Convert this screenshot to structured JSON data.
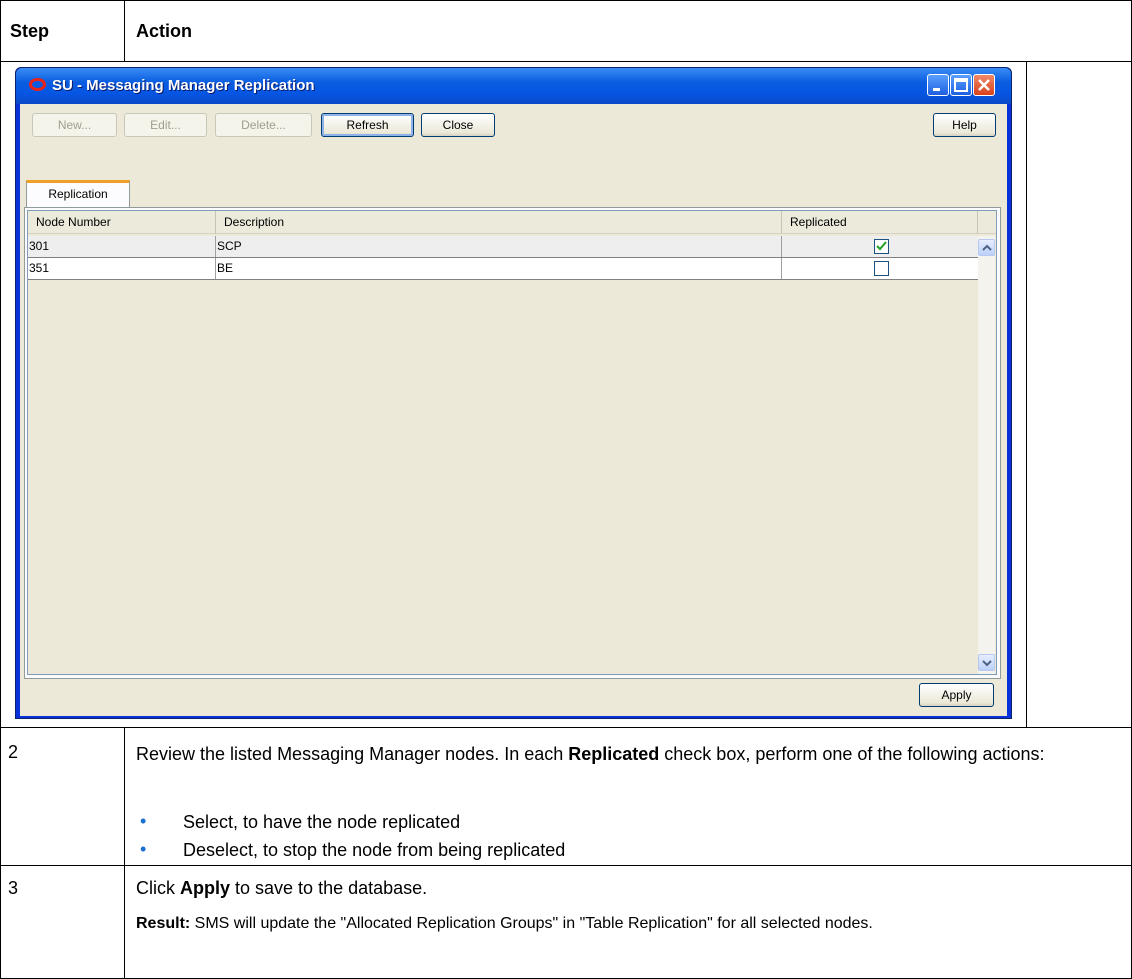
{
  "table": {
    "col_step": "Step",
    "col_action": "Action",
    "rows": [
      {
        "step": "2",
        "intro_pre": "Review the listed Messaging Manager nodes. In each ",
        "intro_bold": "Replicated",
        "intro_post": " check box, perform one of the following actions:",
        "bullets": [
          "Select, to have the node replicated",
          "Deselect, to stop the node from being replicated"
        ]
      },
      {
        "step": "3",
        "line1_pre": "Click ",
        "line1_bold": "Apply",
        "line1_post": " to save to the database.",
        "result_label": "Result:",
        "result_text": " SMS will update the \"Allocated Replication Groups\" in \"Table Replication\" for all selected nodes."
      }
    ]
  },
  "window": {
    "title": "SU - Messaging Manager Replication",
    "toolbar": {
      "new_label": "New...",
      "edit_label": "Edit...",
      "delete_label": "Delete...",
      "refresh_label": "Refresh",
      "close_label": "Close",
      "help_label": "Help"
    },
    "tab_label": "Replication",
    "grid": {
      "headers": [
        "Node Number",
        "Description",
        "Replicated"
      ],
      "rows": [
        {
          "node": "301",
          "description": "SCP",
          "replicated": true
        },
        {
          "node": "351",
          "description": "BE",
          "replicated": false
        }
      ]
    },
    "apply_label": "Apply"
  }
}
